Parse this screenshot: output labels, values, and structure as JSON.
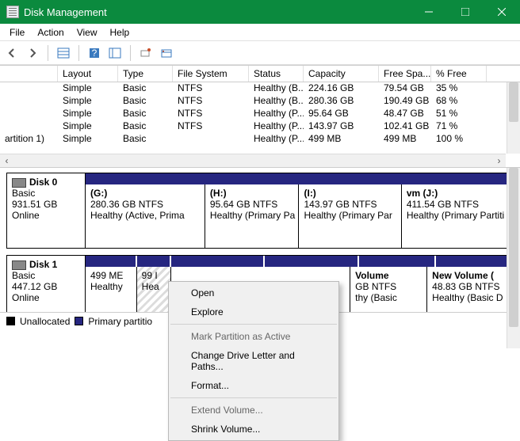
{
  "title": "Disk Management",
  "menu": {
    "file": "File",
    "action": "Action",
    "view": "View",
    "help": "Help"
  },
  "columns": [
    "",
    "Layout",
    "Type",
    "File System",
    "Status",
    "Capacity",
    "Free Spa...",
    "% Free"
  ],
  "rows": [
    {
      "layout": "Simple",
      "type": "Basic",
      "fs": "NTFS",
      "status": "Healthy (B...",
      "cap": "224.16 GB",
      "free": "79.54 GB",
      "pct": "35 %"
    },
    {
      "layout": "Simple",
      "type": "Basic",
      "fs": "NTFS",
      "status": "Healthy (B...",
      "cap": "280.36 GB",
      "free": "190.49 GB",
      "pct": "68 %"
    },
    {
      "layout": "Simple",
      "type": "Basic",
      "fs": "NTFS",
      "status": "Healthy (P...",
      "cap": "95.64 GB",
      "free": "48.47 GB",
      "pct": "51 %"
    },
    {
      "layout": "Simple",
      "type": "Basic",
      "fs": "NTFS",
      "status": "Healthy (P...",
      "cap": "143.97 GB",
      "free": "102.41 GB",
      "pct": "71 %"
    },
    {
      "vol": "artition 1)",
      "layout": "Simple",
      "type": "Basic",
      "fs": "",
      "status": "Healthy (P...",
      "cap": "499 MB",
      "free": "499 MB",
      "pct": "100 %"
    }
  ],
  "disk0": {
    "title": "Disk 0",
    "type": "Basic",
    "size": "931.51 GB",
    "state": "Online",
    "parts": [
      {
        "label": "(G:)",
        "info": "280.36 GB NTFS",
        "status": "Healthy (Active, Prima"
      },
      {
        "label": "(H:)",
        "info": "95.64 GB NTFS",
        "status": "Healthy (Primary Pa"
      },
      {
        "label": "(I:)",
        "info": "143.97 GB NTFS",
        "status": "Healthy (Primary Par"
      },
      {
        "label": "vm  (J:)",
        "info": "411.54 GB NTFS",
        "status": "Healthy (Primary Partiti"
      }
    ]
  },
  "disk1": {
    "title": "Disk 1",
    "type": "Basic",
    "size": "447.12 GB",
    "state": "Online",
    "parts": [
      {
        "label": "",
        "info": "499 ME",
        "status": "Healthy"
      },
      {
        "label": "",
        "info": "99 I",
        "status": "Hea"
      },
      {
        "label": "Volume",
        "info": "GB NTFS",
        "status": "thy (Basic"
      },
      {
        "label": "New Volume  (",
        "info": "48.83 GB NTFS",
        "status": "Healthy (Basic D"
      }
    ]
  },
  "legend": {
    "unalloc": "Unallocated",
    "primary": "Primary partitio"
  },
  "context": {
    "open": "Open",
    "explore": "Explore",
    "mark": "Mark Partition as Active",
    "change": "Change Drive Letter and Paths...",
    "format": "Format...",
    "extend": "Extend Volume...",
    "shrink": "Shrink Volume..."
  }
}
